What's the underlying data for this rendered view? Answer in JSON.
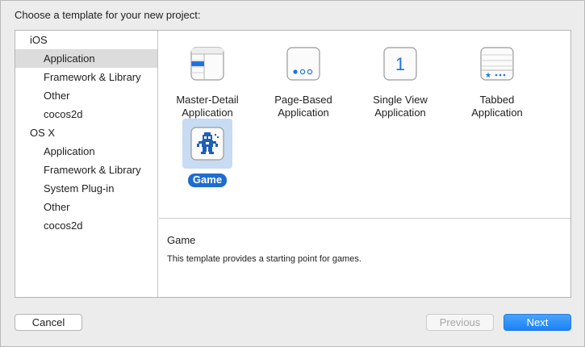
{
  "dialog": {
    "heading": "Choose a template for your new project:"
  },
  "sidebar": {
    "groups": [
      {
        "title": "iOS",
        "items": [
          "Application",
          "Framework & Library",
          "Other",
          "cocos2d"
        ]
      },
      {
        "title": "OS X",
        "items": [
          "Application",
          "Framework & Library",
          "System Plug-in",
          "Other",
          "cocos2d"
        ]
      }
    ],
    "selected": "iOS / Application"
  },
  "templates": [
    {
      "name": "Master-Detail\nApplication",
      "line1": "Master-Detail",
      "line2": "Application",
      "icon": "master-detail-icon"
    },
    {
      "name": "Page-Based Application",
      "line1": "Page-Based",
      "line2": "Application",
      "icon": "page-based-icon"
    },
    {
      "name": "Single View Application",
      "line1": "Single View",
      "line2": "Application",
      "icon": "single-view-icon",
      "glyph": "1"
    },
    {
      "name": "Tabbed Application",
      "line1": "Tabbed",
      "line2": "Application",
      "icon": "tabbed-icon"
    },
    {
      "name": "Game",
      "line1": "Game",
      "icon": "game-icon",
      "selected": true
    }
  ],
  "description": {
    "title": "Game",
    "text": "This template provides a starting point for games."
  },
  "buttons": {
    "cancel": "Cancel",
    "previous": "Previous",
    "next": "Next"
  },
  "colors": {
    "accent": "#1f6cd1",
    "selection_bg": "#c7dbf2",
    "sidebar_selected": "#dcdcdc",
    "primary_button": "#1a82f7"
  }
}
